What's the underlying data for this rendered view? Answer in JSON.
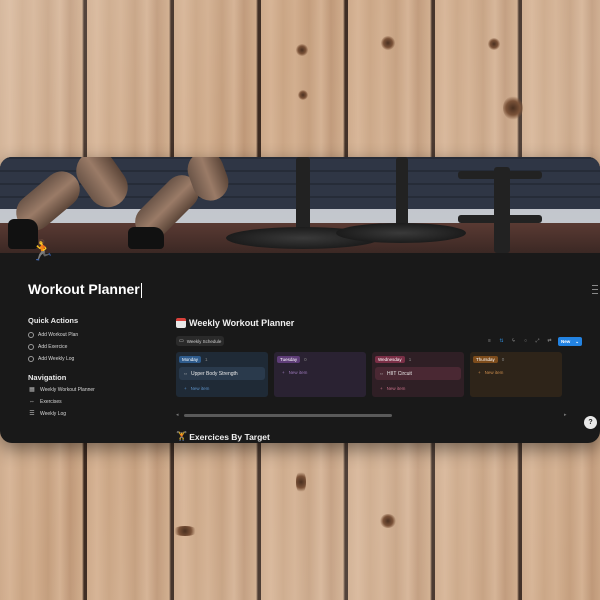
{
  "page": {
    "title": "Workout Planner",
    "icon": "running-person-icon"
  },
  "sidebar": {
    "quick_actions": {
      "heading": "Quick Actions",
      "items": [
        {
          "label": "Add Workout Plan",
          "icon": "circle-icon"
        },
        {
          "label": "Add Exercice",
          "icon": "circle-icon"
        },
        {
          "label": "Add Weekly Log",
          "icon": "circle-icon"
        }
      ]
    },
    "navigation": {
      "heading": "Navigation",
      "items": [
        {
          "label": "Weekly Workout Planner",
          "icon": "calendar-icon"
        },
        {
          "label": "Exercises",
          "icon": "dumbbell-icon"
        },
        {
          "label": "Weekly Log",
          "icon": "list-icon"
        }
      ]
    }
  },
  "board": {
    "title": "Weekly Workout Planner",
    "view_tab": "Weekly Schedule",
    "new_button": "New",
    "new_item_label": "New item",
    "columns": [
      {
        "name": "Monday",
        "count": "1",
        "tag_color": "#2e5b8c",
        "bg": "#1f2a36",
        "card_bg": "#2a3a4c",
        "new_color": "#5b8fc4",
        "cards": [
          "Upper Body Strength"
        ]
      },
      {
        "name": "Tuesday",
        "count": "0",
        "tag_color": "#5e3d77",
        "bg": "#2a2232",
        "card_bg": "#3a2d45",
        "new_color": "#9a77b8",
        "cards": []
      },
      {
        "name": "Wednesday",
        "count": "1",
        "tag_color": "#7a2f46",
        "bg": "#2f1f25",
        "card_bg": "#4a2833",
        "new_color": "#c26d85",
        "cards": [
          "HIIT Circuit"
        ]
      },
      {
        "name": "Thursday",
        "count": "0",
        "tag_color": "#7d4c1c",
        "bg": "#2e2419",
        "card_bg": "#40301f",
        "new_color": "#c98b4c",
        "cards": []
      }
    ]
  },
  "section2": {
    "title": "Exercices By Target",
    "icon": "weightlifter-icon"
  }
}
